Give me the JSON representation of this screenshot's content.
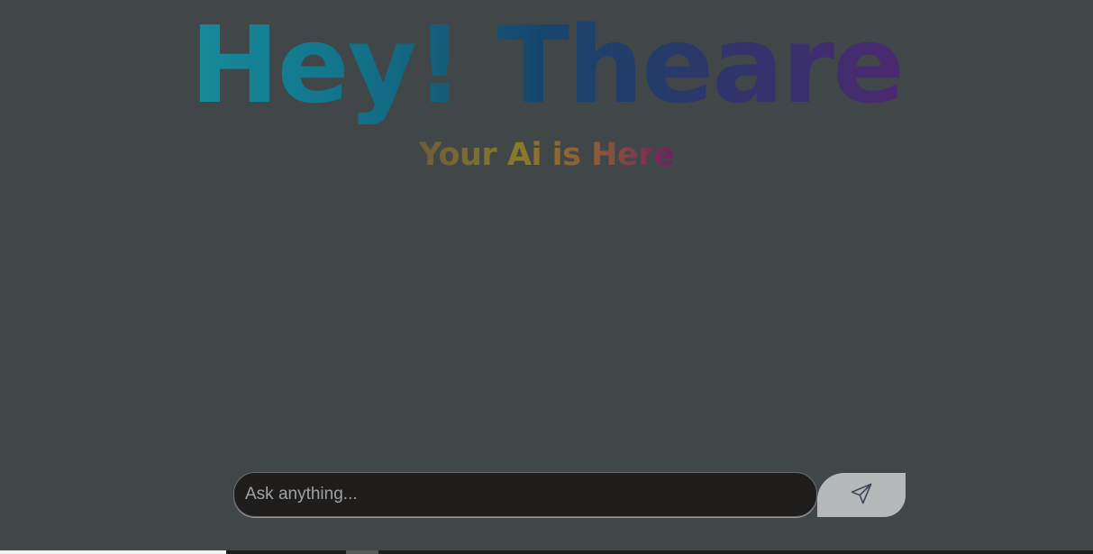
{
  "hero": {
    "title": "Hey! Theare",
    "subtitle": "Your Ai is Here"
  },
  "composer": {
    "placeholder": "Ask anything...",
    "value": "",
    "send_icon": "send-icon"
  },
  "colors": {
    "background": "#414749",
    "input_background": "#1f1c1c",
    "send_button": "#b6b9ba",
    "title_gradient": [
      "#1aa9ad",
      "#12738a",
      "#17456b",
      "#2e356a",
      "#6c1a78"
    ],
    "subtitle_gradient": [
      "#6b5d3a",
      "#8a7a2a",
      "#8a5a3a",
      "#6d1d5d"
    ]
  }
}
